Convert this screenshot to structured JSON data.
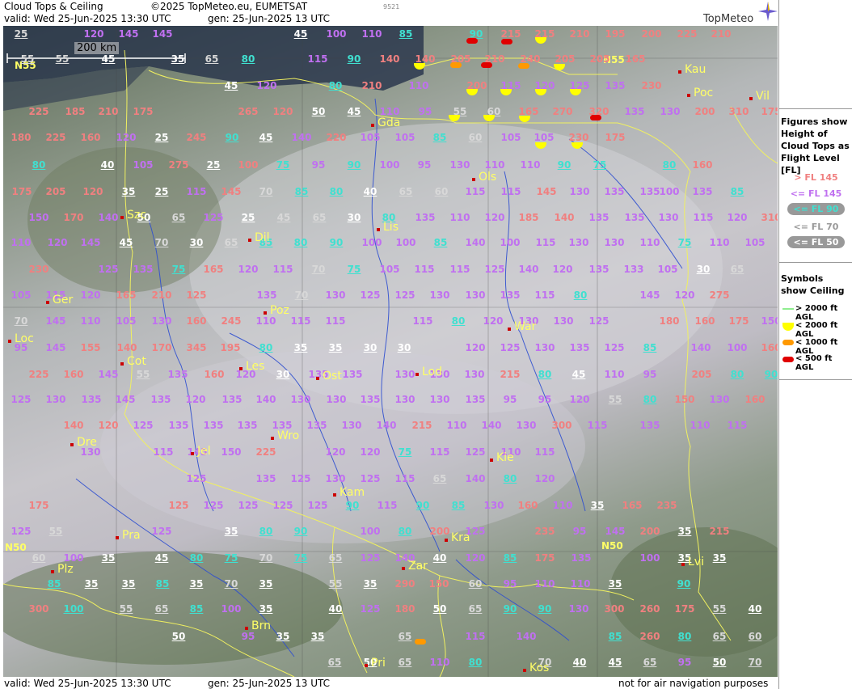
{
  "header": {
    "title": "Cloud Tops & Ceiling",
    "copyright": "©2025 TopMeteo.eu, EUMETSAT",
    "id": "9521",
    "valid": "valid:  Wed  25-Jun-2025  13:30 UTC",
    "gen": "gen: 25-Jun-2025 13 UTC",
    "brand": "TopMeteo"
  },
  "footer": {
    "valid": "valid:  Wed  25-Jun-2025  13:30 UTC",
    "gen": "gen: 25-Jun-2025 13 UTC",
    "note": "not for air navigation purposes"
  },
  "scale_bar": "200 km",
  "colors": {
    "high": "#f08080",
    "mid": "#c070f0",
    "low90": "#40e0d0",
    "low70": "#f0f0f0",
    "low50": "#ffffff",
    "ceil2000": "#ffff00",
    "ceil1000": "#ff9900",
    "ceil500": "#e00000"
  },
  "legend": {
    "heights_title": "Figures show Height of Cloud Tops as Flight Level  [FL]",
    "gt145": "> FL 145",
    "le145": "<= FL 145",
    "le90": "<= FL 90",
    "le70": "<= FL 70",
    "le50": "<= FL 50",
    "ceiling_title": "Symbols show Ceiling",
    "c2000g": "> 2000 ft AGL",
    "c2000": "< 2000 ft AGL",
    "c1000": "< 1000 ft AGL",
    "c500": "< 500 ft AGL"
  },
  "grid_labels": [
    "N55",
    "N55",
    "N50",
    "N50"
  ],
  "cities": [
    "Gda",
    "Kau",
    "Poc",
    "Vil",
    "Ols",
    "Szc",
    "Lis",
    "Dil",
    "Ger",
    "Poz",
    "War",
    "Loc",
    "Cot",
    "Les",
    "Ost",
    "Lod",
    "Dre",
    "Wro",
    "Jel",
    "Kie",
    "Kam",
    "Pra",
    "Kra",
    "Plz",
    "Zar",
    "Lvi",
    "Brn",
    "Pri",
    "Kos"
  ],
  "values": [
    [
      "25",
      "l"
    ],
    [
      "120",
      "m"
    ],
    [
      "145",
      "m"
    ],
    [
      "145",
      "m"
    ],
    [
      "45",
      "w"
    ],
    [
      "100",
      "m"
    ],
    [
      "110",
      "m"
    ],
    [
      "85",
      "c"
    ],
    [
      "90",
      "c"
    ],
    [
      "215",
      "h"
    ],
    [
      "215",
      "h"
    ],
    [
      "210",
      "h"
    ],
    [
      "195",
      "h"
    ],
    [
      "200",
      "h"
    ],
    [
      "225",
      "h"
    ],
    [
      "210",
      "h"
    ],
    [
      "55",
      "l"
    ],
    [
      "55",
      "l"
    ],
    [
      "45",
      "w"
    ],
    [
      "35",
      "w"
    ],
    [
      "65",
      "l"
    ],
    [
      "80",
      "c"
    ],
    [
      "115",
      "m"
    ],
    [
      "90",
      "c"
    ],
    [
      "140",
      "h"
    ],
    [
      "140",
      "h"
    ],
    [
      "205",
      "h"
    ],
    [
      "210",
      "h"
    ],
    [
      "240",
      "h"
    ],
    [
      "205",
      "h"
    ],
    [
      "205",
      "h"
    ],
    [
      "165",
      "h"
    ],
    [
      "45",
      "w"
    ],
    [
      "120",
      "m"
    ],
    [
      "80",
      "c"
    ],
    [
      "210",
      "h"
    ],
    [
      "110",
      "m"
    ],
    [
      "200",
      "h"
    ],
    [
      "115",
      "m"
    ],
    [
      "120",
      "m"
    ],
    [
      "125",
      "m"
    ],
    [
      "135",
      "m"
    ],
    [
      "230",
      "h"
    ],
    [
      "225",
      "h"
    ],
    [
      "185",
      "h"
    ],
    [
      "210",
      "h"
    ],
    [
      "175",
      "h"
    ],
    [
      "265",
      "h"
    ],
    [
      "120",
      "h"
    ],
    [
      "50",
      "w"
    ],
    [
      "45",
      "w"
    ],
    [
      "110",
      "m"
    ],
    [
      "95",
      "m"
    ],
    [
      "55",
      "l"
    ],
    [
      "60",
      "l"
    ],
    [
      "165",
      "h"
    ],
    [
      "270",
      "h"
    ],
    [
      "320",
      "h"
    ],
    [
      "135",
      "m"
    ],
    [
      "130",
      "m"
    ],
    [
      "200",
      "h"
    ],
    [
      "310",
      "h"
    ],
    [
      "175",
      "h"
    ],
    [
      "180",
      "h"
    ],
    [
      "225",
      "h"
    ],
    [
      "160",
      "h"
    ],
    [
      "120",
      "m"
    ],
    [
      "25",
      "w"
    ],
    [
      "245",
      "h"
    ],
    [
      "90",
      "c"
    ],
    [
      "45",
      "w"
    ],
    [
      "140",
      "m"
    ],
    [
      "220",
      "h"
    ],
    [
      "105",
      "m"
    ],
    [
      "105",
      "m"
    ],
    [
      "85",
      "c"
    ],
    [
      "60",
      "l"
    ],
    [
      "105",
      "m"
    ],
    [
      "105",
      "m"
    ],
    [
      "230",
      "h"
    ],
    [
      "175",
      "h"
    ],
    [
      "80",
      "c"
    ],
    [
      "40",
      "w"
    ],
    [
      "105",
      "m"
    ],
    [
      "275",
      "h"
    ],
    [
      "25",
      "w"
    ],
    [
      "100",
      "h"
    ],
    [
      "75",
      "c"
    ],
    [
      "95",
      "m"
    ],
    [
      "90",
      "c"
    ],
    [
      "100",
      "m"
    ],
    [
      "95",
      "m"
    ],
    [
      "130",
      "m"
    ],
    [
      "110",
      "m"
    ],
    [
      "110",
      "m"
    ],
    [
      "90",
      "c"
    ],
    [
      "75",
      "c"
    ],
    [
      "80",
      "c"
    ],
    [
      "160",
      "h"
    ],
    [
      "175",
      "h"
    ],
    [
      "205",
      "h"
    ],
    [
      "120",
      "h"
    ],
    [
      "35",
      "w"
    ],
    [
      "25",
      "w"
    ],
    [
      "115",
      "m"
    ],
    [
      "145",
      "h"
    ],
    [
      "70",
      "l"
    ],
    [
      "85",
      "c"
    ],
    [
      "80",
      "c"
    ],
    [
      "40",
      "w"
    ],
    [
      "65",
      "l"
    ],
    [
      "60",
      "l"
    ],
    [
      "115",
      "m"
    ],
    [
      "115",
      "m"
    ],
    [
      "145",
      "h"
    ],
    [
      "130",
      "m"
    ],
    [
      "135",
      "m"
    ],
    [
      "135",
      "m"
    ],
    [
      "100",
      "m"
    ],
    [
      "135",
      "m"
    ],
    [
      "85",
      "c"
    ],
    [
      "150",
      "m"
    ],
    [
      "170",
      "h"
    ],
    [
      "140",
      "m"
    ],
    [
      "50",
      "w"
    ],
    [
      "65",
      "l"
    ],
    [
      "125",
      "m"
    ],
    [
      "25",
      "w"
    ],
    [
      "45",
      "l"
    ],
    [
      "65",
      "l"
    ],
    [
      "30",
      "w"
    ],
    [
      "80",
      "c"
    ],
    [
      "135",
      "m"
    ],
    [
      "110",
      "m"
    ],
    [
      "120",
      "m"
    ],
    [
      "185",
      "h"
    ],
    [
      "140",
      "h"
    ],
    [
      "135",
      "m"
    ],
    [
      "135",
      "m"
    ],
    [
      "130",
      "m"
    ],
    [
      "115",
      "m"
    ],
    [
      "120",
      "m"
    ],
    [
      "310",
      "h"
    ],
    [
      "110",
      "m"
    ],
    [
      "120",
      "m"
    ],
    [
      "145",
      "m"
    ],
    [
      "45",
      "w"
    ],
    [
      "70",
      "l"
    ],
    [
      "30",
      "w"
    ],
    [
      "65",
      "l"
    ],
    [
      "85",
      "c"
    ],
    [
      "80",
      "c"
    ],
    [
      "90",
      "c"
    ],
    [
      "100",
      "m"
    ],
    [
      "100",
      "m"
    ],
    [
      "85",
      "c"
    ],
    [
      "140",
      "m"
    ],
    [
      "100",
      "m"
    ],
    [
      "115",
      "m"
    ],
    [
      "130",
      "m"
    ],
    [
      "130",
      "m"
    ],
    [
      "110",
      "m"
    ],
    [
      "75",
      "c"
    ],
    [
      "110",
      "m"
    ],
    [
      "105",
      "m"
    ],
    [
      "230",
      "h"
    ],
    [
      "125",
      "m"
    ],
    [
      "135",
      "m"
    ],
    [
      "75",
      "c"
    ],
    [
      "165",
      "h"
    ],
    [
      "120",
      "m"
    ],
    [
      "115",
      "m"
    ],
    [
      "70",
      "l"
    ],
    [
      "75",
      "c"
    ],
    [
      "105",
      "m"
    ],
    [
      "115",
      "m"
    ],
    [
      "115",
      "m"
    ],
    [
      "125",
      "m"
    ],
    [
      "140",
      "m"
    ],
    [
      "120",
      "m"
    ],
    [
      "135",
      "m"
    ],
    [
      "133",
      "m"
    ],
    [
      "105",
      "m"
    ],
    [
      "30",
      "w"
    ],
    [
      "65",
      "l"
    ],
    [
      "105",
      "m"
    ],
    [
      "115",
      "m"
    ],
    [
      "120",
      "m"
    ],
    [
      "165",
      "h"
    ],
    [
      "210",
      "h"
    ],
    [
      "125",
      "h"
    ],
    [
      "135",
      "m"
    ],
    [
      "70",
      "l"
    ],
    [
      "130",
      "m"
    ],
    [
      "125",
      "m"
    ],
    [
      "125",
      "m"
    ],
    [
      "130",
      "m"
    ],
    [
      "130",
      "m"
    ],
    [
      "135",
      "m"
    ],
    [
      "115",
      "m"
    ],
    [
      "80",
      "c"
    ],
    [
      "145",
      "m"
    ],
    [
      "120",
      "m"
    ],
    [
      "275",
      "h"
    ],
    [
      "70",
      "l"
    ],
    [
      "145",
      "m"
    ],
    [
      "110",
      "m"
    ],
    [
      "105",
      "m"
    ],
    [
      "130",
      "m"
    ],
    [
      "160",
      "h"
    ],
    [
      "245",
      "h"
    ],
    [
      "110",
      "m"
    ],
    [
      "115",
      "m"
    ],
    [
      "115",
      "m"
    ],
    [
      "115",
      "m"
    ],
    [
      "80",
      "c"
    ],
    [
      "120",
      "m"
    ],
    [
      "130",
      "m"
    ],
    [
      "130",
      "m"
    ],
    [
      "125",
      "m"
    ],
    [
      "180",
      "h"
    ],
    [
      "160",
      "h"
    ],
    [
      "175",
      "h"
    ],
    [
      "150",
      "m"
    ],
    [
      "95",
      "m"
    ],
    [
      "145",
      "m"
    ],
    [
      "155",
      "h"
    ],
    [
      "140",
      "h"
    ],
    [
      "170",
      "h"
    ],
    [
      "345",
      "h"
    ],
    [
      "195",
      "h"
    ],
    [
      "80",
      "c"
    ],
    [
      "35",
      "w"
    ],
    [
      "35",
      "w"
    ],
    [
      "30",
      "w"
    ],
    [
      "30",
      "w"
    ],
    [
      "120",
      "m"
    ],
    [
      "125",
      "m"
    ],
    [
      "130",
      "m"
    ],
    [
      "135",
      "m"
    ],
    [
      "125",
      "m"
    ],
    [
      "85",
      "c"
    ],
    [
      "140",
      "m"
    ],
    [
      "100",
      "m"
    ],
    [
      "160",
      "h"
    ],
    [
      "225",
      "h"
    ],
    [
      "160",
      "h"
    ],
    [
      "145",
      "m"
    ],
    [
      "55",
      "l"
    ],
    [
      "135",
      "m"
    ],
    [
      "160",
      "h"
    ],
    [
      "120",
      "m"
    ],
    [
      "30",
      "w"
    ],
    [
      "135",
      "m"
    ],
    [
      "135",
      "m"
    ],
    [
      "130",
      "m"
    ],
    [
      "130",
      "m"
    ],
    [
      "130",
      "m"
    ],
    [
      "215",
      "h"
    ],
    [
      "80",
      "c"
    ],
    [
      "45",
      "w"
    ],
    [
      "110",
      "m"
    ],
    [
      "95",
      "m"
    ],
    [
      "205",
      "h"
    ],
    [
      "80",
      "c"
    ],
    [
      "90",
      "c"
    ],
    [
      "125",
      "m"
    ],
    [
      "130",
      "m"
    ],
    [
      "135",
      "m"
    ],
    [
      "145",
      "m"
    ],
    [
      "135",
      "m"
    ],
    [
      "120",
      "m"
    ],
    [
      "135",
      "m"
    ],
    [
      "140",
      "m"
    ],
    [
      "130",
      "m"
    ],
    [
      "130",
      "m"
    ],
    [
      "135",
      "m"
    ],
    [
      "130",
      "m"
    ],
    [
      "130",
      "m"
    ],
    [
      "135",
      "m"
    ],
    [
      "95",
      "m"
    ],
    [
      "95",
      "m"
    ],
    [
      "120",
      "m"
    ],
    [
      "55",
      "l"
    ],
    [
      "80",
      "c"
    ],
    [
      "150",
      "h"
    ],
    [
      "130",
      "m"
    ],
    [
      "160",
      "h"
    ],
    [
      "140",
      "h"
    ],
    [
      "120",
      "h"
    ],
    [
      "125",
      "m"
    ],
    [
      "135",
      "m"
    ],
    [
      "135",
      "m"
    ],
    [
      "135",
      "m"
    ],
    [
      "135",
      "m"
    ],
    [
      "135",
      "m"
    ],
    [
      "130",
      "m"
    ],
    [
      "140",
      "m"
    ],
    [
      "215",
      "h"
    ],
    [
      "110",
      "m"
    ],
    [
      "140",
      "m"
    ],
    [
      "130",
      "m"
    ],
    [
      "300",
      "h"
    ],
    [
      "115",
      "m"
    ],
    [
      "135",
      "m"
    ],
    [
      "110",
      "m"
    ],
    [
      "115",
      "m"
    ],
    [
      "130",
      "m"
    ],
    [
      "115",
      "m"
    ],
    [
      "145",
      "m"
    ],
    [
      "150",
      "m"
    ],
    [
      "225",
      "h"
    ],
    [
      "120",
      "m"
    ],
    [
      "120",
      "m"
    ],
    [
      "75",
      "c"
    ],
    [
      "115",
      "m"
    ],
    [
      "125",
      "m"
    ],
    [
      "110",
      "m"
    ],
    [
      "115",
      "m"
    ],
    [
      "125",
      "m"
    ],
    [
      "135",
      "m"
    ],
    [
      "125",
      "m"
    ],
    [
      "130",
      "m"
    ],
    [
      "125",
      "m"
    ],
    [
      "115",
      "m"
    ],
    [
      "65",
      "l"
    ],
    [
      "140",
      "m"
    ],
    [
      "80",
      "c"
    ],
    [
      "120",
      "m"
    ],
    [
      "175",
      "h"
    ],
    [
      "125",
      "h"
    ],
    [
      "125",
      "m"
    ],
    [
      "125",
      "m"
    ],
    [
      "125",
      "m"
    ],
    [
      "125",
      "m"
    ],
    [
      "90",
      "c"
    ],
    [
      "115",
      "m"
    ],
    [
      "90",
      "c"
    ],
    [
      "85",
      "c"
    ],
    [
      "130",
      "m"
    ],
    [
      "160",
      "h"
    ],
    [
      "110",
      "m"
    ],
    [
      "35",
      "w"
    ],
    [
      "165",
      "h"
    ],
    [
      "235",
      "h"
    ],
    [
      "125",
      "m"
    ],
    [
      "55",
      "l"
    ],
    [
      "125",
      "m"
    ],
    [
      "35",
      "w"
    ],
    [
      "80",
      "c"
    ],
    [
      "90",
      "c"
    ],
    [
      "100",
      "m"
    ],
    [
      "80",
      "c"
    ],
    [
      "200",
      "h"
    ],
    [
      "125",
      "m"
    ],
    [
      "235",
      "h"
    ],
    [
      "95",
      "m"
    ],
    [
      "145",
      "m"
    ],
    [
      "200",
      "h"
    ],
    [
      "35",
      "w"
    ],
    [
      "215",
      "h"
    ],
    [
      "60",
      "l"
    ],
    [
      "100",
      "m"
    ],
    [
      "35",
      "w"
    ],
    [
      "45",
      "w"
    ],
    [
      "80",
      "c"
    ],
    [
      "75",
      "c"
    ],
    [
      "70",
      "l"
    ],
    [
      "75",
      "c"
    ],
    [
      "65",
      "l"
    ],
    [
      "125",
      "m"
    ],
    [
      "140",
      "m"
    ],
    [
      "40",
      "w"
    ],
    [
      "120",
      "m"
    ],
    [
      "85",
      "c"
    ],
    [
      "175",
      "h"
    ],
    [
      "135",
      "m"
    ],
    [
      "100",
      "m"
    ],
    [
      "35",
      "w"
    ],
    [
      "35",
      "w"
    ],
    [
      "85",
      "c"
    ],
    [
      "35",
      "w"
    ],
    [
      "35",
      "w"
    ],
    [
      "85",
      "c"
    ],
    [
      "35",
      "w"
    ],
    [
      "70",
      "l"
    ],
    [
      "35",
      "w"
    ],
    [
      "55",
      "l"
    ],
    [
      "35",
      "w"
    ],
    [
      "290",
      "h"
    ],
    [
      "150",
      "h"
    ],
    [
      "60",
      "l"
    ],
    [
      "95",
      "m"
    ],
    [
      "110",
      "m"
    ],
    [
      "110",
      "m"
    ],
    [
      "35",
      "w"
    ],
    [
      "90",
      "c"
    ],
    [
      "300",
      "h"
    ],
    [
      "100",
      "c"
    ],
    [
      "55",
      "l"
    ],
    [
      "65",
      "l"
    ],
    [
      "85",
      "c"
    ],
    [
      "100",
      "m"
    ],
    [
      "35",
      "w"
    ],
    [
      "40",
      "w"
    ],
    [
      "125",
      "m"
    ],
    [
      "180",
      "h"
    ],
    [
      "50",
      "w"
    ],
    [
      "65",
      "l"
    ],
    [
      "90",
      "c"
    ],
    [
      "90",
      "c"
    ],
    [
      "130",
      "m"
    ],
    [
      "300",
      "h"
    ],
    [
      "260",
      "h"
    ],
    [
      "175",
      "h"
    ],
    [
      "55",
      "l"
    ],
    [
      "40",
      "w"
    ],
    [
      "50",
      "w"
    ],
    [
      "95",
      "m"
    ],
    [
      "35",
      "w"
    ],
    [
      "35",
      "w"
    ],
    [
      "65",
      "l"
    ],
    [
      "115",
      "m"
    ],
    [
      "140",
      "m"
    ],
    [
      "85",
      "c"
    ],
    [
      "260",
      "h"
    ],
    [
      "80",
      "c"
    ],
    [
      "65",
      "l"
    ],
    [
      "60",
      "l"
    ],
    [
      "65",
      "l"
    ],
    [
      "50",
      "w"
    ],
    [
      "65",
      "l"
    ],
    [
      "110",
      "m"
    ],
    [
      "80",
      "c"
    ],
    [
      "70",
      "l"
    ],
    [
      "40",
      "w"
    ],
    [
      "45",
      "w"
    ],
    [
      "65",
      "l"
    ],
    [
      "95",
      "m"
    ],
    [
      "50",
      "w"
    ],
    [
      "70",
      "l"
    ]
  ]
}
